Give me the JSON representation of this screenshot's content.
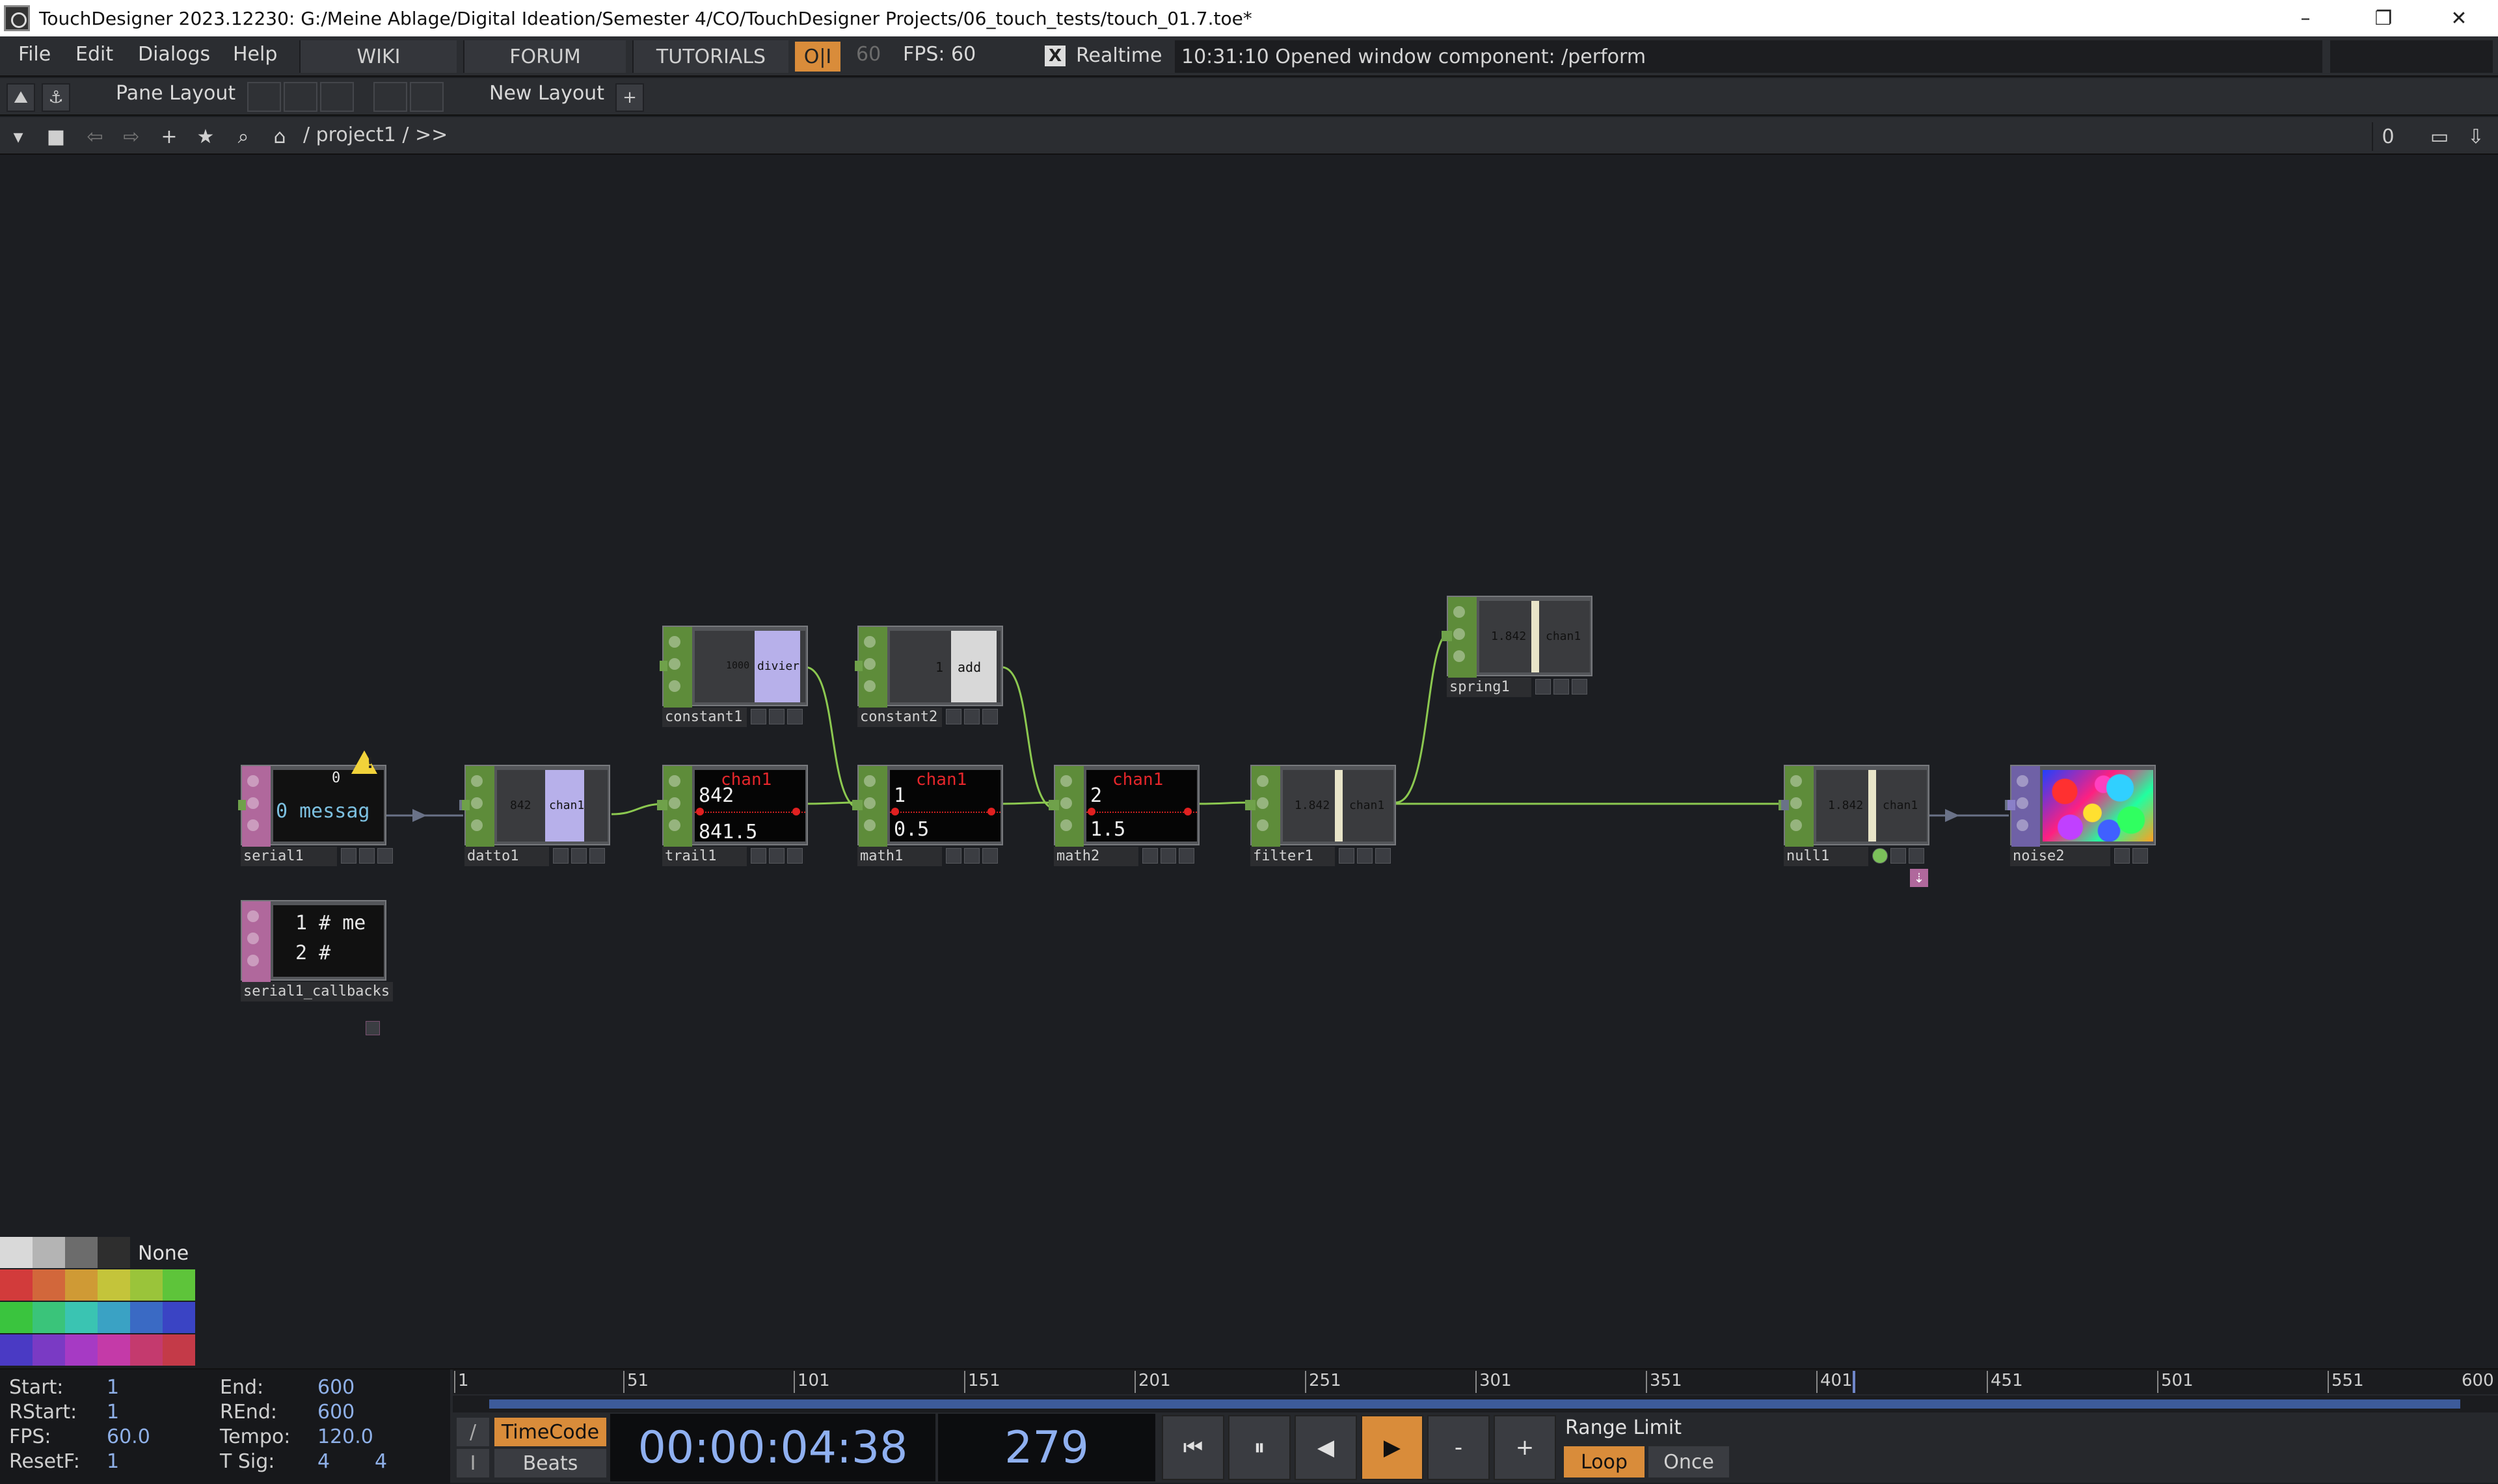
{
  "window": {
    "title": "TouchDesigner 2023.12230: G:/Meine Ablage/Digital Ideation/Semester 4/CO/TouchDesigner Projects/06_touch_tests/touch_01.7.toe*",
    "controls": {
      "minimize": "–",
      "restore": "❐",
      "close": "✕"
    }
  },
  "menu": {
    "items": [
      "File",
      "Edit",
      "Dialogs",
      "Help"
    ],
    "links": [
      "WIKI",
      "FORUM",
      "TUTORIALS"
    ],
    "oi_label": "O|I",
    "fps_cap": "60",
    "fps_text": "FPS:  60",
    "realtime_check": "X",
    "realtime_label": "Realtime",
    "status_message": "10:31:10 Opened window component: /perform"
  },
  "pane": {
    "pane_layout_label": "Pane Layout",
    "new_layout_label": "New Layout",
    "add_symbol": "+"
  },
  "path": {
    "text": "/ project1 / >>",
    "pane_index": "0"
  },
  "nodes": [
    {
      "id": "serial1",
      "label": "serial1",
      "family": "dat",
      "line1": "0",
      "line2": "0 messag"
    },
    {
      "id": "serial1_callbacks",
      "label": "serial1_callbacks",
      "family": "dat",
      "line1": "1 # me",
      "line2": "2 #"
    },
    {
      "id": "datto1",
      "label": "datto1",
      "family": "chop",
      "bar_value": "842",
      "bar_name": "chan1"
    },
    {
      "id": "constant1",
      "label": "constant1",
      "family": "chop",
      "bar_value": "1000",
      "bar_name": "divier"
    },
    {
      "id": "constant2",
      "label": "constant2",
      "family": "chop",
      "bar_value": "1",
      "bar_name": "add"
    },
    {
      "id": "trail1",
      "label": "trail1",
      "family": "chop",
      "graph_name": "chan1",
      "v1": "842",
      "v2": "841.5"
    },
    {
      "id": "math1",
      "label": "math1",
      "family": "chop",
      "graph_name": "chan1",
      "v1": "1",
      "v2": "0.5"
    },
    {
      "id": "math2",
      "label": "math2",
      "family": "chop",
      "graph_name": "chan1",
      "v1": "2",
      "v2": "1.5"
    },
    {
      "id": "filter1",
      "label": "filter1",
      "family": "chop",
      "bar_value": "1.842",
      "bar_name": "chan1"
    },
    {
      "id": "spring1",
      "label": "spring1",
      "family": "chop",
      "bar_value": "1.842",
      "bar_name": "chan1"
    },
    {
      "id": "null1",
      "label": "null1",
      "family": "chop",
      "bar_value": "1.842",
      "bar_name": "chan1"
    },
    {
      "id": "noise2",
      "label": "noise2",
      "family": "top"
    }
  ],
  "palette": {
    "none_label": "None",
    "colors": [
      "#d9d9d9",
      "#b4b4b4",
      "#6c6c6c",
      "#2e2e2e",
      "#d23b3b",
      "#d2673b",
      "#cf9a35",
      "#c4c43a",
      "#9ac43a",
      "#5ec43a",
      "#3ac43e",
      "#3ac47a",
      "#3ac4b2",
      "#3aa2c4",
      "#3a6ac4",
      "#3a44c4",
      "#4a3ac4",
      "#7a3ac4",
      "#a63ac4",
      "#c43aa8",
      "#c43a6e",
      "#c43a48"
    ]
  },
  "timeline": {
    "start_label": "Start:",
    "start": "1",
    "rstart_label": "RStart:",
    "rstart": "1",
    "fps_label": "FPS:",
    "fps": "60.0",
    "resetf_label": "ResetF:",
    "resetf": "1",
    "end_label": "End:",
    "end": "600",
    "rend_label": "REnd:",
    "rend": "600",
    "tempo_label": "Tempo:",
    "tempo": "120.0",
    "tsig_label": "T Sig:",
    "tsig_a": "4",
    "tsig_b": "4",
    "ticks": [
      "1",
      "51",
      "101",
      "151",
      "201",
      "251",
      "301",
      "351",
      "401",
      "451",
      "501",
      "551",
      "600"
    ],
    "current_frame_value": 279,
    "slash_btn": "/",
    "i_btn": "I",
    "timecode_btn": "TimeCode",
    "beats_btn": "Beats",
    "timecode": "00:00:04:38",
    "frame": "279",
    "transport": {
      "to_start": "⏮",
      "pause": "⏸",
      "step_back": "◀",
      "play": "▶",
      "minus": "-",
      "plus": "+"
    },
    "range_limit_label": "Range Limit",
    "loop_btn": "Loop",
    "once_btn": "Once"
  },
  "colors": {
    "chop": "#5e8c3a",
    "dat": "#b0689c",
    "top": "#6f61a6",
    "accent": "#d98c3a",
    "wire": "#8cc850"
  }
}
